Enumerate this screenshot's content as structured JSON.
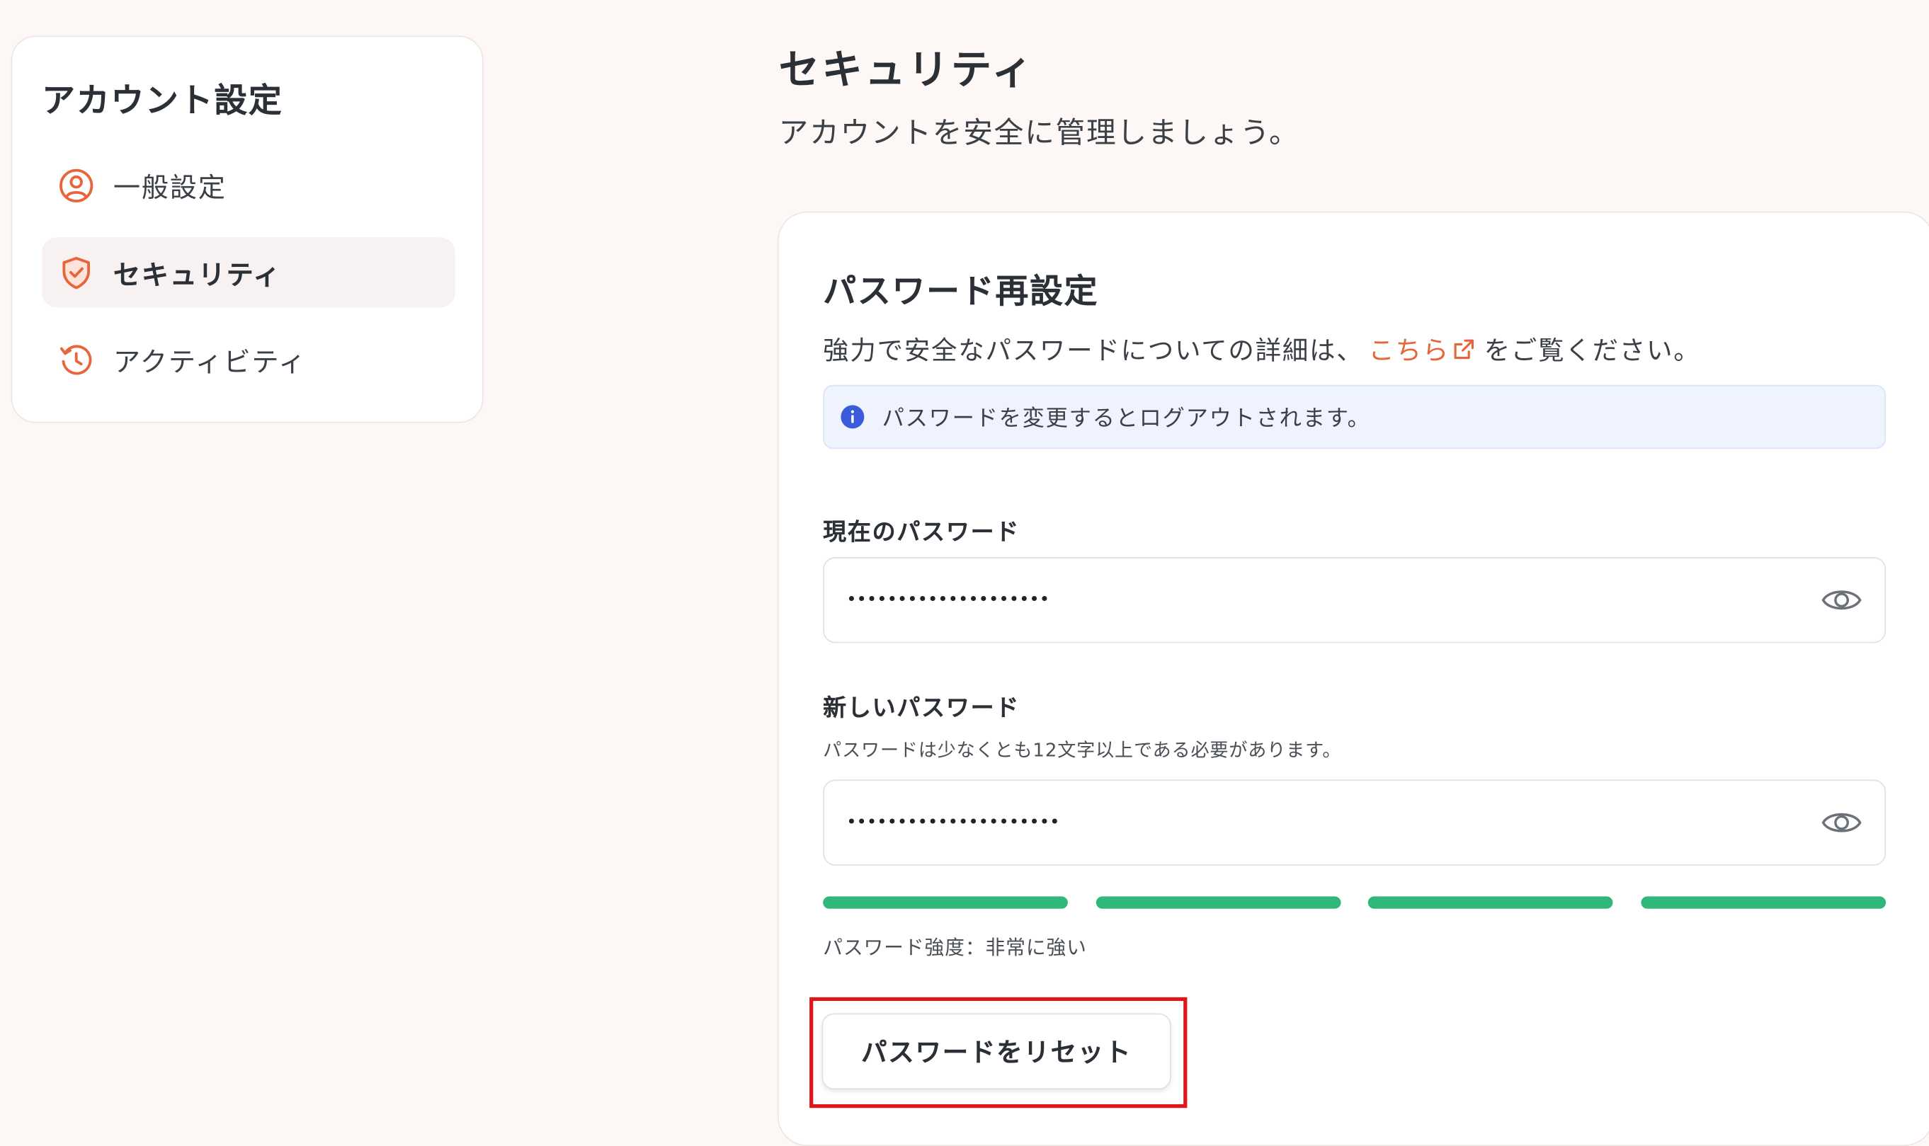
{
  "colors": {
    "background": "#fdf7f6",
    "accent": "#e8643b",
    "info": "#3b5bdb",
    "strength": "#2fb879",
    "highlight": "#e0161c"
  },
  "sidebar": {
    "title": "アカウント設定",
    "items": [
      {
        "label": "一般設定",
        "icon": "user-circle-icon",
        "active": false
      },
      {
        "label": "セキュリティ",
        "icon": "shield-check-icon",
        "active": true
      },
      {
        "label": "アクティビティ",
        "icon": "history-icon",
        "active": false
      }
    ]
  },
  "header": {
    "title": "セキュリティ",
    "subtitle": "アカウントを安全に管理しましょう。"
  },
  "card": {
    "title": "パスワード再設定",
    "desc_before": "強力で安全なパスワードについての詳細は、",
    "desc_link": "こちら",
    "desc_after": "をご覧ください。",
    "info_text": "パスワードを変更するとログアウトされます。",
    "current_password": {
      "label": "現在のパスワード",
      "value": "••••••••••••••••••••"
    },
    "new_password": {
      "label": "新しいパスワード",
      "help": "パスワードは少なくとも12文字以上である必要があります。",
      "value": "•••••••••••••••••••••"
    },
    "strength": {
      "segments_filled": 4,
      "segments_total": 4,
      "label": "パスワード強度：非常に強い"
    },
    "reset_label": "パスワードをリセット"
  }
}
